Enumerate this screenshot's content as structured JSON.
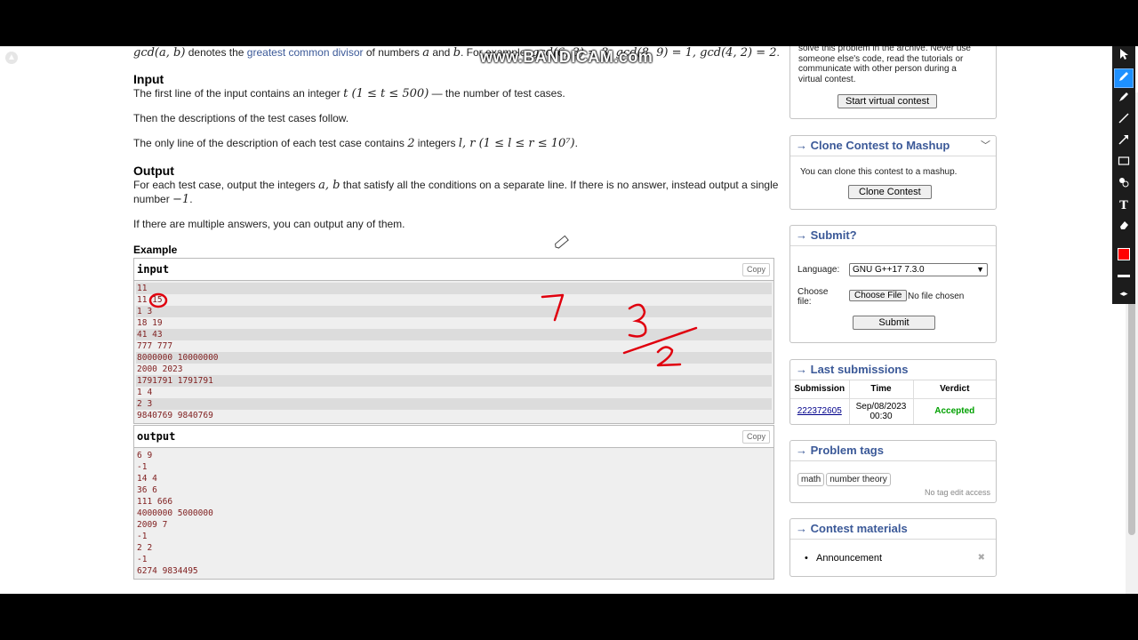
{
  "watermark": "www.BANDICAM.com",
  "statement": {
    "gcd_line": {
      "pre": "gcd(a, b)",
      "t1": " denotes the ",
      "link": "greatest common divisor",
      "t2": " of numbers ",
      "a": "a",
      "t3": " and ",
      "b": "b",
      "t4": ". For example, ",
      "ex": "gcd(6, 3) = 3, gcd(8, 9) = 1, gcd(4, 2) = 2",
      "end": "."
    },
    "input_title": "Input",
    "input_p1_pre": "The first line of the input contains an integer ",
    "input_p1_math": "t (1 ≤ t ≤ 500)",
    "input_p1_post": " — the number of test cases.",
    "input_p2": "Then the descriptions of the test cases follow.",
    "input_p3_pre": "The only line of the description of each test case contains ",
    "input_p3_m1": "2",
    "input_p3_mid": " integers ",
    "input_p3_m2": "l, r (1 ≤ l ≤ r ≤ 10⁷)",
    "input_p3_post": ".",
    "output_title": "Output",
    "output_p1_pre": "For each test case, output the integers ",
    "output_p1_math": "a, b",
    "output_p1_post": " that satisfy all the conditions on a separate line. If there is no answer, instead output a single",
    "output_p1_l2_pre": "number ",
    "output_p1_l2_math": "−1",
    "output_p1_l2_post": ".",
    "output_p2": "If there are multiple answers, you can output any of them.",
    "example_title": "Example",
    "input_label": "input",
    "output_label": "output",
    "copy_label": "Copy",
    "input_lines": [
      "11",
      "11 15",
      "1 3",
      "18 19",
      "41 43",
      "777 777",
      "8000000 10000000",
      "2000 2023",
      "1791791 1791791",
      "1 4",
      "2 3",
      "9840769 9840769"
    ],
    "output_lines": [
      "6 9",
      "-1",
      "14 4",
      "36 6",
      "111 666",
      "4000000 5000000",
      "2009 7",
      "-1",
      "2 2",
      "-1",
      "6274 9834495"
    ]
  },
  "sidebar": {
    "virtual": {
      "text_lines": [
        "solve this problem in the archive. Never use",
        "someone else's code, read the tutorials or",
        "communicate with other person during a",
        "virtual contest."
      ],
      "button": "Start virtual contest"
    },
    "clone": {
      "title": "Clone Contest to Mashup",
      "text": "You can clone this contest to a mashup.",
      "button": "Clone Contest"
    },
    "submit": {
      "title": "Submit?",
      "language_label": "Language:",
      "language_value": "GNU G++17 7.3.0",
      "file_label_1": "Choose",
      "file_label_2": "file:",
      "file_button": "Choose File",
      "file_status": "No file chosen",
      "submit_button": "Submit"
    },
    "last_submissions": {
      "title": "Last submissions",
      "headers": [
        "Submission",
        "Time",
        "Verdict"
      ],
      "row": {
        "id": "222372605",
        "time_1": "Sep/08/2023",
        "time_2": "00:30",
        "verdict": "Accepted"
      }
    },
    "tags": {
      "title": "Problem tags",
      "items": [
        "math",
        "number theory"
      ],
      "note": "No tag edit access"
    },
    "materials": {
      "title": "Contest materials",
      "item": "Announcement"
    }
  },
  "colors": {
    "link": "#3b5998",
    "accepted": "#00a000",
    "ink": "#e0000e",
    "sample_text": "#802020"
  },
  "icons": [
    "cursor-icon",
    "pen-icon",
    "highlighter-icon",
    "line-icon",
    "arrow-icon",
    "rectangle-icon",
    "stamp-icon",
    "text-icon",
    "eraser-icon",
    "color-swatch-icon",
    "line-width-icon",
    "expand-icon"
  ]
}
